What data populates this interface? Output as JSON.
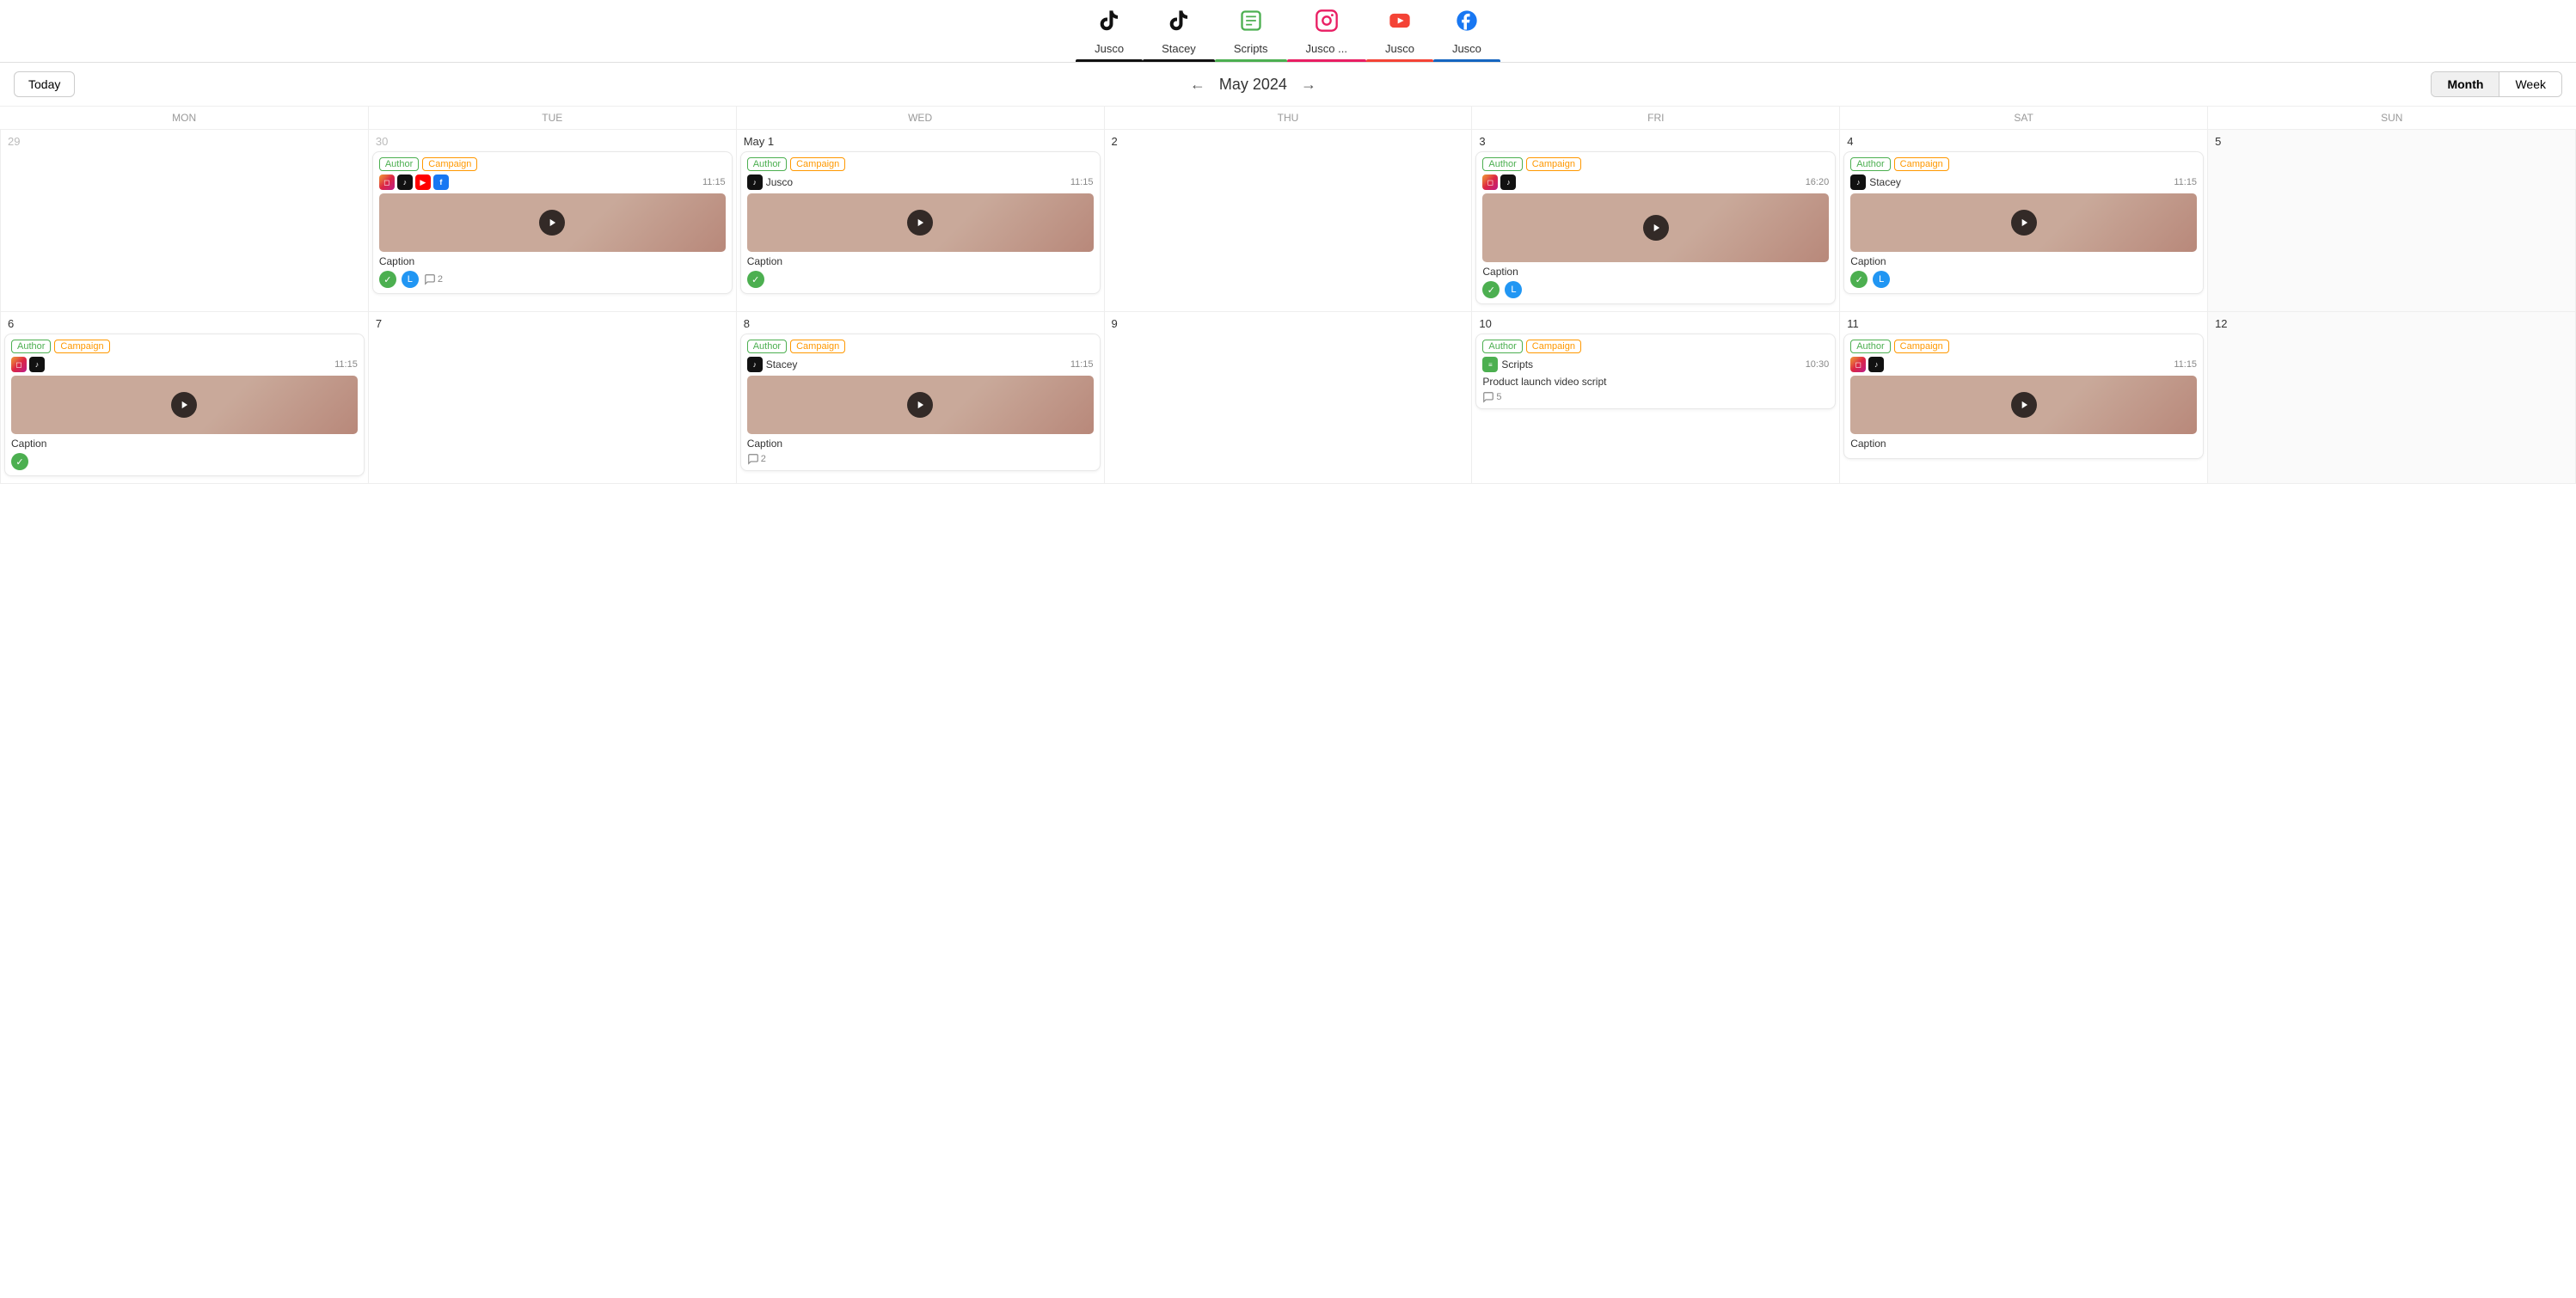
{
  "nav": {
    "items": [
      {
        "id": "jusco1",
        "label": "Jusco",
        "icon": "♪",
        "active": "active-black"
      },
      {
        "id": "stacey",
        "label": "Stacey",
        "icon": "♪",
        "active": "active-black"
      },
      {
        "id": "scripts",
        "label": "Scripts",
        "icon": "▦",
        "active": "active-green"
      },
      {
        "id": "jusco2",
        "label": "Jusco ...",
        "icon": "◻",
        "active": "active-pink"
      },
      {
        "id": "jusco3",
        "label": "Jusco",
        "icon": "▶",
        "active": "active-red"
      },
      {
        "id": "jusco4",
        "label": "Jusco",
        "icon": "f",
        "active": "active-blue"
      }
    ]
  },
  "calendar": {
    "today_label": "Today",
    "month_year": "May 2024",
    "view_month": "Month",
    "view_week": "Week",
    "days": [
      "MON",
      "TUE",
      "WED",
      "THU",
      "FRI",
      "SAT",
      "SUN"
    ]
  },
  "tags": {
    "author": "Author",
    "campaign": "Campaign"
  },
  "events": {
    "apr30": {
      "icons": [
        "ig",
        "tt",
        "yt",
        "fb"
      ],
      "time": "11:15",
      "caption": "Caption",
      "statuses": [
        "green",
        "blue"
      ],
      "comments": 2
    },
    "may1": {
      "platform": "Jusco",
      "time": "11:15",
      "caption": "Caption",
      "statuses": [
        "green"
      ]
    },
    "may3": {
      "icons": [
        "ig",
        "tt"
      ],
      "time": "16:20",
      "caption": "Caption",
      "statuses": [
        "green",
        "blue"
      ]
    },
    "may4": {
      "platform": "Stacey",
      "time": "11:15",
      "caption": "Caption",
      "statuses": [
        "green",
        "blue"
      ]
    },
    "may6": {
      "icons": [
        "ig",
        "tt"
      ],
      "time": "11:15",
      "caption": "Caption",
      "statuses": [
        "green"
      ]
    },
    "may8": {
      "platform": "Stacey",
      "time": "11:15",
      "caption": "Caption",
      "comments": 2
    },
    "may10": {
      "platform": "Scripts",
      "time": "10:30",
      "title": "Product launch video script",
      "comments": 5
    },
    "may11": {
      "icons": [
        "ig",
        "tt"
      ],
      "time": "11:15",
      "caption": "Caption"
    }
  }
}
